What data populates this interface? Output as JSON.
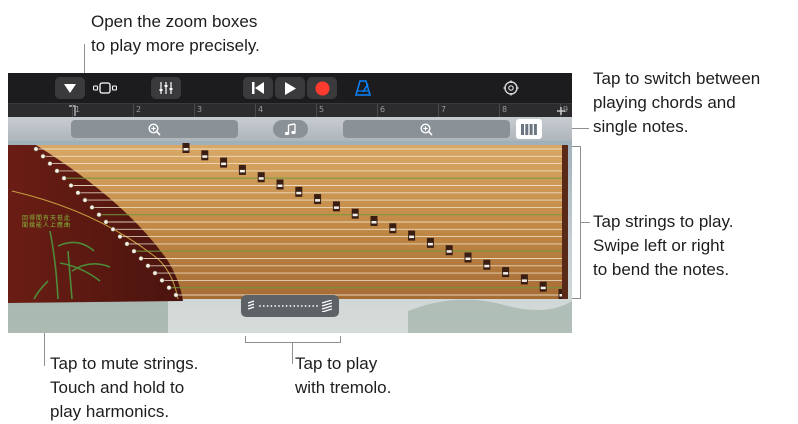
{
  "callouts": {
    "zoom": "Open the zoom boxes\nto play more precisely.",
    "switch": "Tap to switch between\nplaying chords and\nsingle notes.",
    "strings": "Tap strings to play.\nSwipe left or right\nto bend the notes.",
    "mute": "Tap to mute strings.\nTouch and hold to\nplay harmonics.",
    "tremolo": "Tap to play\nwith tremolo."
  },
  "ruler": {
    "ticks": [
      "1",
      "2",
      "3",
      "4",
      "5",
      "6",
      "7",
      "8",
      "9"
    ]
  },
  "toolbar": {
    "icons": [
      "view-menu-icon",
      "browser-icon",
      "mixer-icon",
      "rewind-icon",
      "play-icon",
      "record-icon",
      "metronome-icon",
      "settings-icon"
    ],
    "record_color": "#ff3b30",
    "metronome_color": "#0a84ff"
  },
  "instrument": {
    "name": "guzheng",
    "calligraphy": [
      "此",
      "曲",
      "祇",
      "應",
      "天",
      "上",
      "有",
      "人",
      "間",
      "能",
      "得",
      "幾",
      "回",
      "聞"
    ],
    "string_count": 21
  },
  "colors": {
    "wood": "#c7924e",
    "dark_wood": "#5a1a12",
    "bridge": "#3a1e14"
  }
}
